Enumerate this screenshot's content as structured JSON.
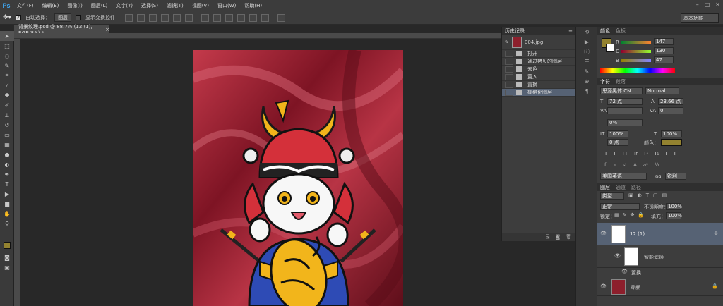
{
  "app": {
    "logo": "Ps"
  },
  "menu": [
    "文件(F)",
    "编辑(E)",
    "图像(I)",
    "图层(L)",
    "文字(Y)",
    "选择(S)",
    "滤镜(T)",
    "视图(V)",
    "窗口(W)",
    "帮助(H)"
  ],
  "options": {
    "auto_select_label": "自动选择：",
    "auto_select_value": "图层",
    "transform_label": "显示变换控件",
    "workspace": "基本功能"
  },
  "document": {
    "tab_title": "背景纹理.psd @ 88.7% (12 (1), RGB/8#) *"
  },
  "history": {
    "title": "历史记录",
    "snapshot": "004.jpg",
    "items": [
      "打开",
      "通过拷贝的图层",
      "去色",
      "置入",
      "置换",
      "栅格化图层"
    ]
  },
  "color": {
    "tabs": [
      "颜色",
      "色板"
    ],
    "r_label": "R",
    "g_label": "G",
    "b_label": "B",
    "r": "147",
    "g": "130",
    "b": "47",
    "fg_color": "#938230"
  },
  "character": {
    "tabs": [
      "字符",
      "段落"
    ],
    "font_family": "思源黑体 CN",
    "font_style": "Normal",
    "size": "72 点",
    "leading": "23.66 点",
    "kerning": "",
    "tracking": "0",
    "scale_pct": "0%",
    "vscale": "100%",
    "hscale": "100%",
    "baseline": "0 点",
    "color_label": "颜色：",
    "styles": [
      "T",
      "T",
      "TT",
      "Tr",
      "T¹",
      "T₁",
      "T",
      "T̶"
    ],
    "language": "美国英语",
    "aa_label": "aa",
    "antialias": "锐利"
  },
  "layers": {
    "tabs": [
      "图层",
      "通道",
      "路径"
    ],
    "filter_kind": "类型",
    "blend_mode": "正常",
    "opacity_label": "不透明度：",
    "opacity": "100%",
    "lock_label": "锁定：",
    "fill_label": "填充：",
    "fill": "100%",
    "items": [
      {
        "name": "12 (1)"
      },
      {
        "name": "智能滤镜"
      },
      {
        "name": "置换"
      },
      {
        "name": "背景"
      }
    ]
  },
  "bottom_icons": [
    "link-icon",
    "new-icon",
    "trash-icon"
  ]
}
